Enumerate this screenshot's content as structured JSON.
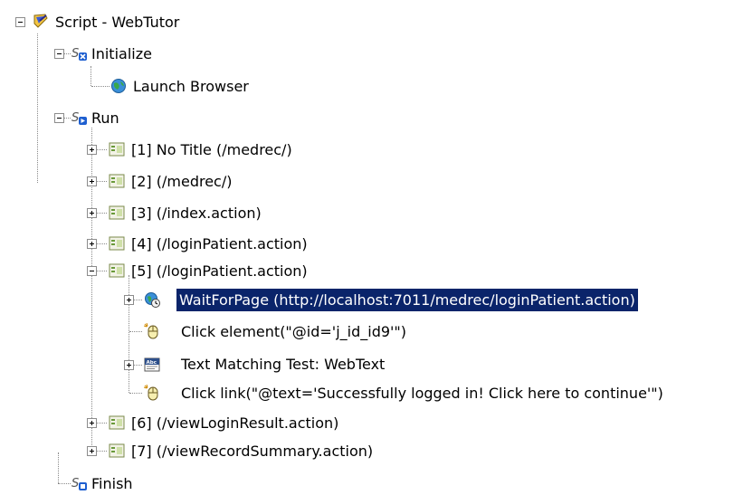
{
  "tree": {
    "root": {
      "label": "Script - WebTutor",
      "icon": "script-icon"
    },
    "initialize": {
      "label": "Initialize",
      "icon": "section-initialize-icon"
    },
    "launch_browser": {
      "label": "Launch Browser",
      "icon": "globe-icon"
    },
    "run": {
      "label": "Run",
      "icon": "section-run-icon"
    },
    "pages": [
      {
        "label": "[1] No Title (/medrec/)"
      },
      {
        "label": "[2]  (/medrec/)"
      },
      {
        "label": "[3]  (/index.action)"
      },
      {
        "label": "[4]  (/loginPatient.action)"
      },
      {
        "label": "[5]  (/loginPatient.action)"
      },
      {
        "label": "[6]  (/viewLoginResult.action)"
      },
      {
        "label": "[7]  (/viewRecordSummary.action)"
      }
    ],
    "page5_children": [
      {
        "label": "WaitForPage (http://localhost:7011/medrec/loginPatient.action)",
        "icon": "wait-for-page-icon",
        "selected": true
      },
      {
        "label": "Click element(\"@id='j_id_id9'\")",
        "icon": "mouse-click-icon"
      },
      {
        "label": "Text Matching Test: WebText",
        "icon": "text-test-icon"
      },
      {
        "label": "Click link(\"@text='Successfully logged in! Click here to continue'\")",
        "icon": "mouse-click-icon"
      }
    ],
    "finish": {
      "label": "Finish",
      "icon": "section-finish-icon"
    }
  },
  "colors": {
    "selection_bg": "#0a246a",
    "selection_text": "#ffffff",
    "tree_line": "#8a8a8a"
  }
}
